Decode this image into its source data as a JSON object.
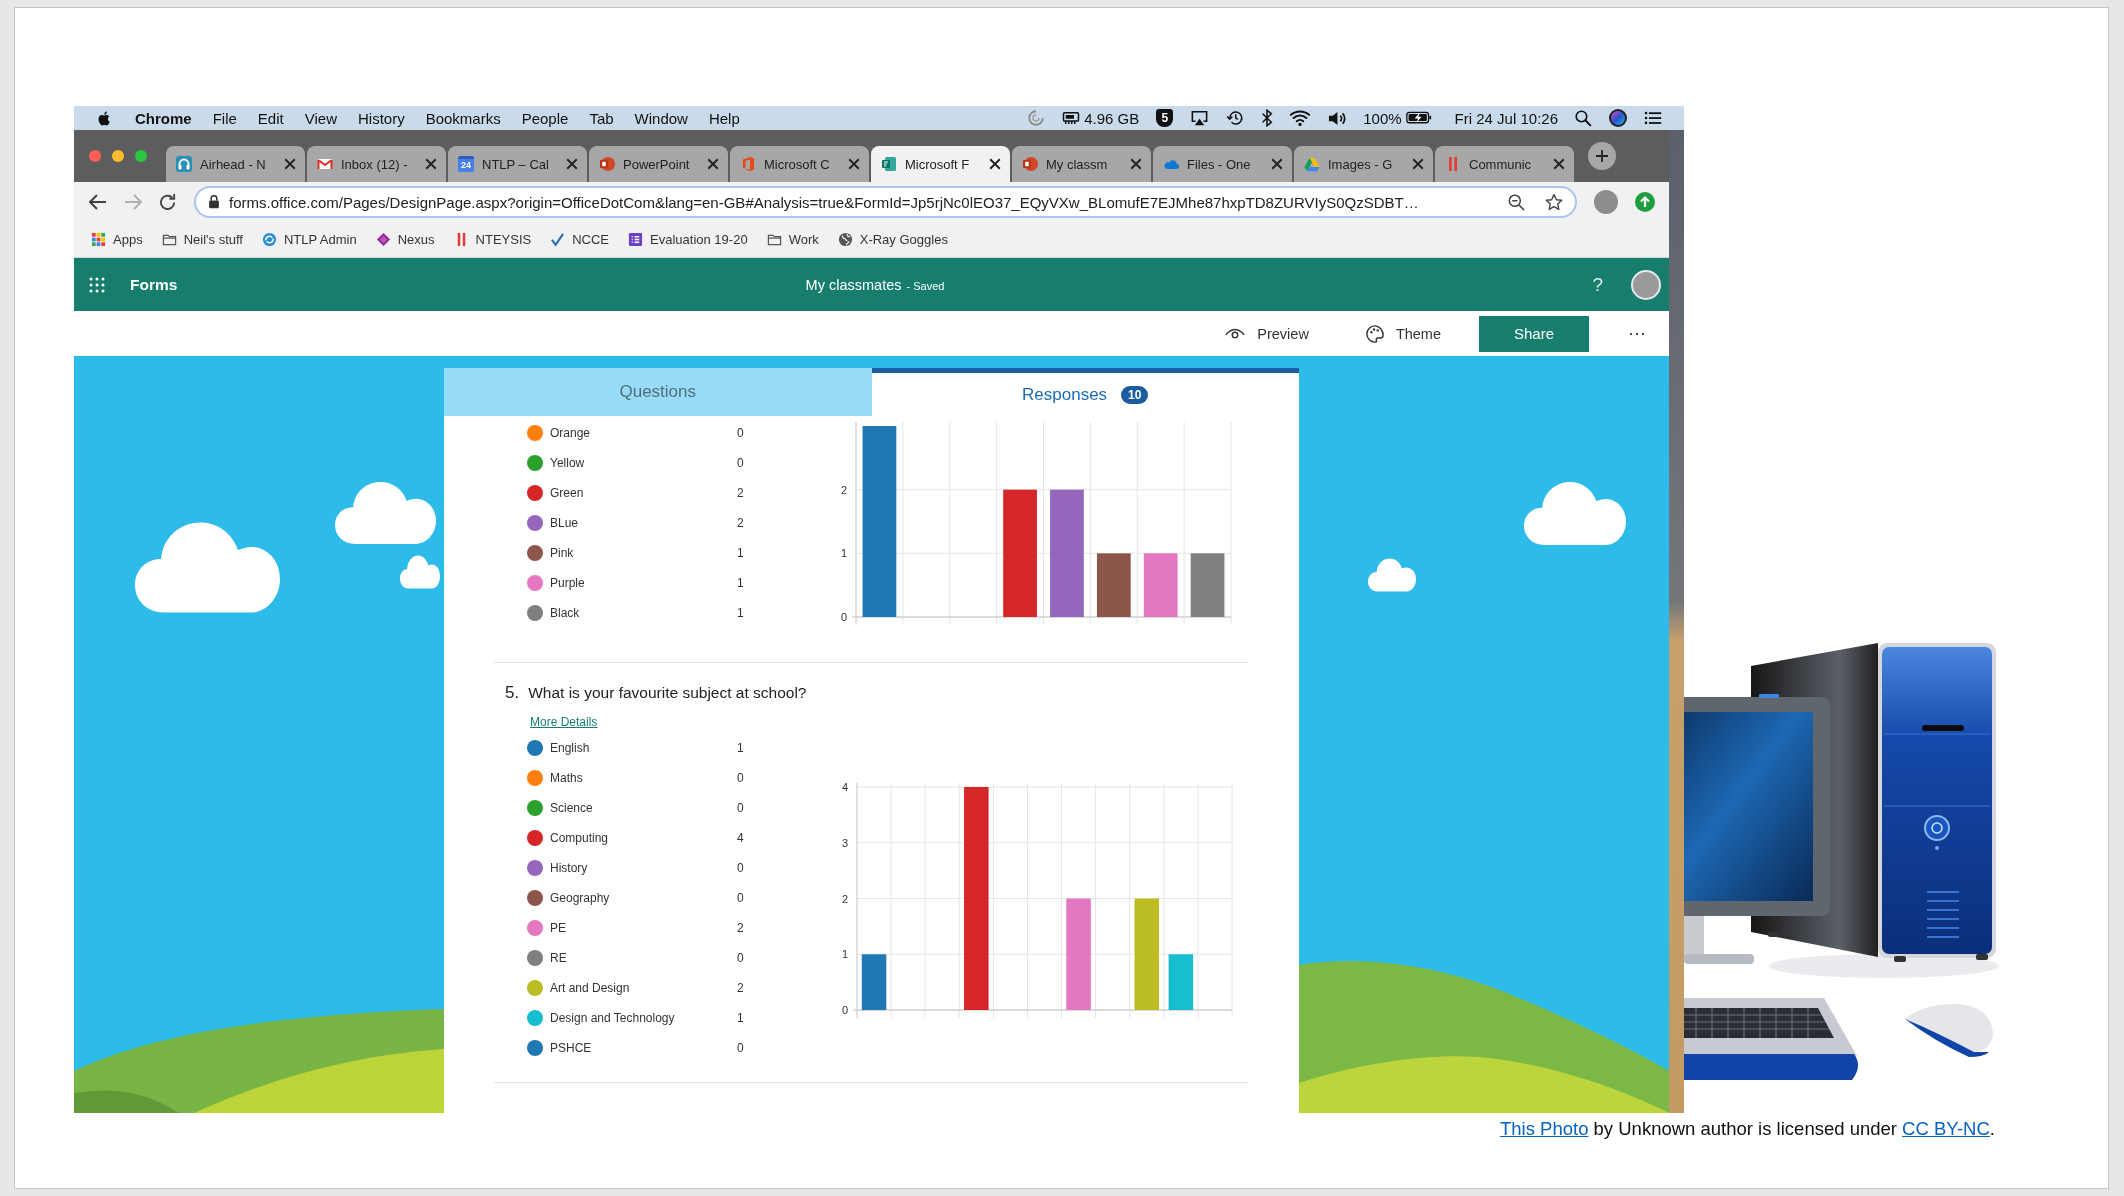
{
  "menu_bar": {
    "app_name": "Chrome",
    "menus": [
      "File",
      "Edit",
      "View",
      "History",
      "Bookmarks",
      "People",
      "Tab",
      "Window",
      "Help"
    ],
    "memory": "4.96 GB",
    "badge": "5",
    "battery": "100%",
    "clock": "Fri 24 Jul 10:26"
  },
  "browser": {
    "tabs": [
      {
        "title": "Airhead - N",
        "selected": false
      },
      {
        "title": "Inbox (12) -",
        "selected": false
      },
      {
        "title": "NTLP – Cal",
        "icon_text": "24",
        "selected": false
      },
      {
        "title": "PowerPoint",
        "selected": false
      },
      {
        "title": "Microsoft C",
        "selected": false
      },
      {
        "title": "Microsoft F",
        "selected": true
      },
      {
        "title": "My classm",
        "selected": false
      },
      {
        "title": "Files - One",
        "selected": false
      },
      {
        "title": "Images - G",
        "selected": false
      },
      {
        "title": "Communic",
        "selected": false
      }
    ],
    "nav": {
      "back_disabled": false,
      "forward_disabled": true
    },
    "url": "forms.office.com/Pages/DesignPage.aspx?origin=OfficeDotCom&lang=en-GB#Analysis=true&FormId=Jp5rjNc0lEO37_EQyVXw_BLomufE7EJMhe87hxpTD8ZURVIyS0QzSDBT…",
    "bookmarks": [
      "Apps",
      "Neil's stuff",
      "NTLP Admin",
      "Nexus",
      "NTEYSIS",
      "NCCE",
      "Evaluation 19-20",
      "Work",
      "X-Ray Goggles"
    ]
  },
  "forms": {
    "app_name": "Forms",
    "form_title": "My classmates",
    "save_status": "- Saved",
    "help": "?",
    "toolbar": {
      "preview": "Preview",
      "theme": "Theme",
      "share": "Share",
      "more": "···"
    },
    "view_tabs": [
      {
        "label": "Questions",
        "selected": false
      },
      {
        "label": "Responses",
        "count": "10",
        "selected": true
      }
    ],
    "questions": [
      {
        "options": [
          {
            "label": "Orange",
            "count": "0",
            "color": "#ff7f0e"
          },
          {
            "label": "Yellow",
            "count": "0",
            "color": "#2ca02c"
          },
          {
            "label": "Green",
            "count": "2",
            "color": "#d62728"
          },
          {
            "label": "BLue",
            "count": "2",
            "color": "#9467bd"
          },
          {
            "label": "Pink",
            "count": "1",
            "color": "#8c564b"
          },
          {
            "label": "Purple",
            "count": "1",
            "color": "#e377c2"
          },
          {
            "label": "Black",
            "count": "1",
            "color": "#7f7f7f"
          }
        ],
        "chart_data": {
          "type": "bar",
          "values": [
            3,
            0,
            0,
            2,
            2,
            1,
            1,
            1
          ],
          "colors": [
            "#1f77b4",
            null,
            null,
            "#d62728",
            "#9467bd",
            "#8c564b",
            "#e377c2",
            "#7f7f7f"
          ],
          "ylim": [
            0,
            3
          ],
          "yticks": [
            0,
            1,
            2
          ],
          "grid": true
        }
      },
      {
        "number": "5.",
        "title": "What is your favourite subject at school?",
        "details_link": "More Details",
        "options": [
          {
            "label": "English",
            "count": "1",
            "color": "#1f77b4"
          },
          {
            "label": "Maths",
            "count": "0",
            "color": "#ff7f0e"
          },
          {
            "label": "Science",
            "count": "0",
            "color": "#2ca02c"
          },
          {
            "label": "Computing",
            "count": "4",
            "color": "#d62728"
          },
          {
            "label": "History",
            "count": "0",
            "color": "#9467bd"
          },
          {
            "label": "Geography",
            "count": "0",
            "color": "#8c564b"
          },
          {
            "label": "PE",
            "count": "2",
            "color": "#e377c2"
          },
          {
            "label": "RE",
            "count": "0",
            "color": "#7f7f7f"
          },
          {
            "label": "Art and Design",
            "count": "2",
            "color": "#bcbd22"
          },
          {
            "label": "Design and Technology",
            "count": "1",
            "color": "#17becf"
          },
          {
            "label": "PSHCE",
            "count": "0",
            "color": "#1f77b4"
          }
        ],
        "chart_data": {
          "type": "bar",
          "values": [
            1,
            0,
            0,
            4,
            0,
            0,
            2,
            0,
            2,
            1,
            0
          ],
          "colors": [
            "#1f77b4",
            null,
            null,
            "#d62728",
            null,
            null,
            "#e377c2",
            null,
            "#bcbd22",
            "#17becf",
            null
          ],
          "ylim": [
            0,
            4
          ],
          "yticks": [
            0,
            1,
            2,
            3,
            4
          ],
          "grid": true
        }
      }
    ]
  },
  "caption": [
    {
      "kind": "link",
      "text": "This Photo"
    },
    {
      "kind": "text",
      "text": " by Unknown author is licensed under "
    },
    {
      "kind": "link",
      "text": "CC BY-NC"
    },
    {
      "kind": "text",
      "text": "."
    }
  ]
}
